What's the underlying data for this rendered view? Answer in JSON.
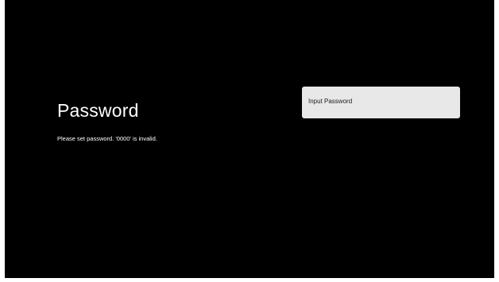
{
  "screen": {
    "title": "Password",
    "description": "Please set password. '0000' is invalid.",
    "input": {
      "label": "Input Password"
    }
  },
  "colors": {
    "background": "#000000",
    "text": "#ffffff",
    "tile": "#e8e8e8",
    "tile_text": "#1a1a1a"
  }
}
